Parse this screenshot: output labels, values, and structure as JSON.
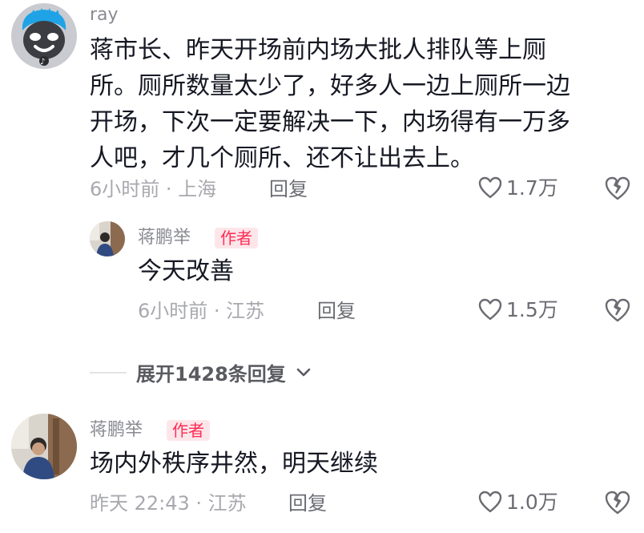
{
  "comments": [
    {
      "username": "ray",
      "is_author": false,
      "lines": [
        "蒋市长、昨天开场前内场大批人排队等上厕",
        "所。厕所数量太少了，好多人一边上厕所一边",
        "开场，下次一定要解决一下，内场得有一万多",
        "人吧，才几个厕所、还不让出去上。"
      ],
      "meta": "6小时前 · 上海",
      "reply_label": "回复",
      "likes": "1.7万",
      "avatar_icon": "blue-hair-cartoon-avatar",
      "replies": [
        {
          "username": "蒋鹏举",
          "author_badge": "作者",
          "text": "今天改善",
          "meta": "6小时前 · 江苏",
          "reply_label": "回复",
          "likes": "1.5万",
          "avatar_icon": "person-photo-avatar"
        }
      ],
      "expand_label": "展开1428条回复"
    },
    {
      "username": "蒋鹏举",
      "author_badge": "作者",
      "text": "场内外秩序井然，明天继续",
      "meta": "昨天 22:43 · 江苏",
      "reply_label": "回复",
      "likes": "1.0万",
      "avatar_icon": "person-photo-avatar"
    }
  ],
  "colors": {
    "author_badge_bg": "#fde6ea",
    "author_badge_text": "#fe2c55",
    "meta_gray": "#a8a9ae",
    "username_gray": "#8a8b91"
  }
}
